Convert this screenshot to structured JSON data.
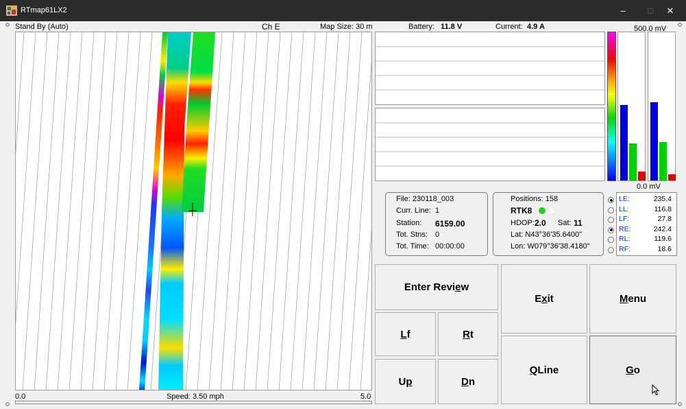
{
  "window": {
    "title": "RTmap61LX2",
    "minimize": "–",
    "maximize": "□",
    "close": "✕"
  },
  "map": {
    "status": "Stand By (Auto)",
    "channel": "Ch E",
    "map_size_label": "Map Size:",
    "map_size_value": "30 m",
    "scale_min": "0.0",
    "scale_max": "5.0",
    "speed_label": "Speed:",
    "speed_value": "3.50 mph"
  },
  "header": {
    "battery_label": "Battery:",
    "battery_value": "11.8 V",
    "current_label": "Current:",
    "current_value": "4.9 A",
    "meter_max": "500.0 mV",
    "meter_min": "0.0 mV"
  },
  "meters": {
    "left": [
      {
        "name": "LE",
        "level": 0.51,
        "color": "#0000e0"
      },
      {
        "name": "LL",
        "level": 0.25,
        "color": "#00d000"
      },
      {
        "name": "LF",
        "level": 0.06,
        "color": "#e00000"
      }
    ],
    "right": [
      {
        "name": "RE",
        "level": 0.53,
        "color": "#0000e0"
      },
      {
        "name": "RL",
        "level": 0.26,
        "color": "#00d000"
      },
      {
        "name": "RF",
        "level": 0.04,
        "color": "#e00000"
      }
    ]
  },
  "file_info": {
    "file": "File: 230118_003",
    "curr_line_label": "Curr. Line:",
    "curr_line_value": "1",
    "station_label": "Station:",
    "station_value": "6159.00",
    "tot_stns_label": "Tot. Stns:",
    "tot_stns_value": "0",
    "tot_time_label": "Tot. Time:",
    "tot_time_value": "00:00:00"
  },
  "gps": {
    "positions": "Positions: 158",
    "fix": "RTK8",
    "hdop_label": "HDOP:",
    "hdop_value": "2.0",
    "sat_label": "Sat:",
    "sat_value": "11",
    "lat": "Lat: N43°36'35.6400\"",
    "lon": "Lon: W079°36'38.4180\""
  },
  "channels": [
    {
      "label": "LE:",
      "value": "235.4",
      "selected": true
    },
    {
      "label": "LL:",
      "value": "116.8",
      "selected": false
    },
    {
      "label": "LF:",
      "value": "27.8",
      "selected": false
    },
    {
      "label": "RE:",
      "value": "242.4",
      "selected": true
    },
    {
      "label": "RL:",
      "value": "119.6",
      "selected": false
    },
    {
      "label": "RF:",
      "value": "18.6",
      "selected": false
    }
  ],
  "buttons": {
    "enter_review_a": "Enter Revi",
    "enter_review_u": "e",
    "enter_review_b": "w",
    "exit_a": "E",
    "exit_u": "x",
    "exit_b": "it",
    "menu_u": "M",
    "menu_b": "enu",
    "lf_u": "L",
    "lf_b": "f",
    "rt_u": "R",
    "rt_b": "t",
    "up_a": "U",
    "up_u": "p",
    "dn_u": "D",
    "dn_b": "n",
    "qline_u": "Q",
    "qline_b": "Line",
    "go_u": "G",
    "go_b": "o"
  }
}
